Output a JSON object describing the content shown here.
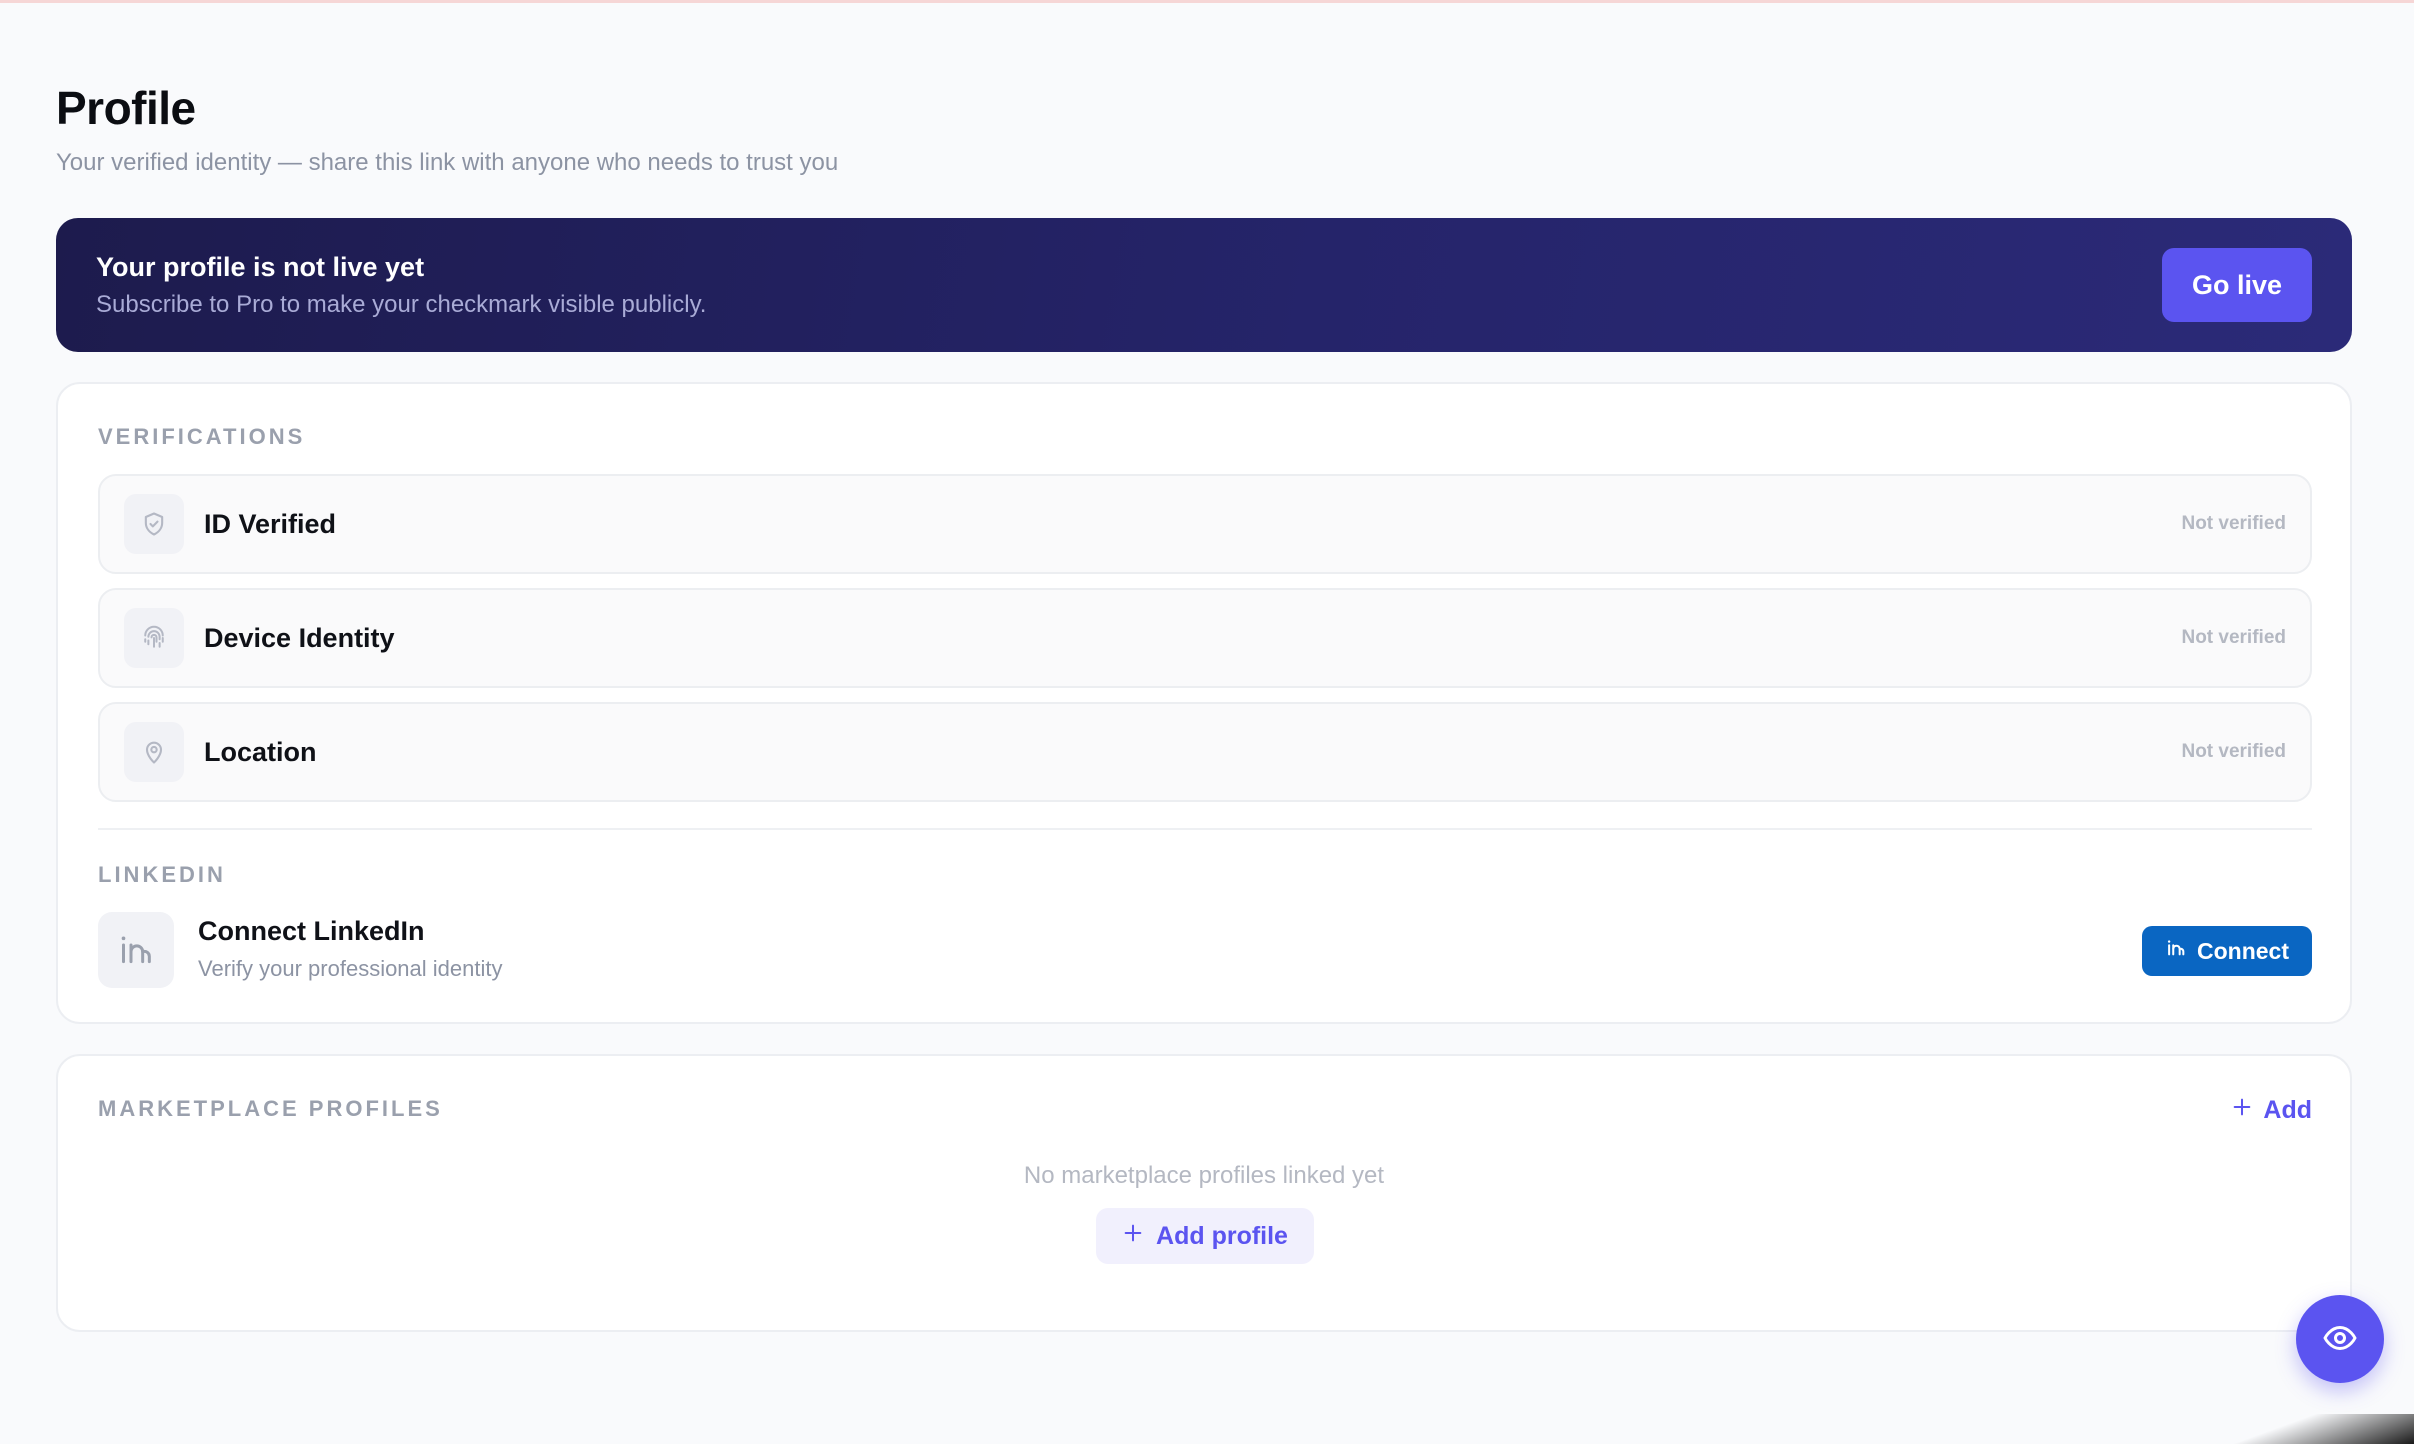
{
  "header": {
    "title": "Profile",
    "subtitle": "Your verified identity — share this link with anyone who needs to trust you"
  },
  "banner": {
    "title": "Your profile is not live yet",
    "subtitle": "Subscribe to Pro to make your checkmark visible publicly.",
    "button_label": "Go live"
  },
  "verifications": {
    "section_label": "VERIFICATIONS",
    "items": [
      {
        "name": "ID Verified",
        "status": "Not verified",
        "icon": "shield-check-icon"
      },
      {
        "name": "Device Identity",
        "status": "Not verified",
        "icon": "fingerprint-icon"
      },
      {
        "name": "Location",
        "status": "Not verified",
        "icon": "map-pin-icon"
      }
    ]
  },
  "linkedin": {
    "section_label": "LINKEDIN",
    "title": "Connect LinkedIn",
    "subtitle": "Verify your professional identity",
    "button_label": "Connect",
    "brand_color": "#0a66c2"
  },
  "marketplace": {
    "section_label": "MARKETPLACE PROFILES",
    "add_label": "Add",
    "empty_text": "No marketplace profiles linked yet",
    "add_profile_label": "Add profile"
  },
  "colors": {
    "accent": "#5b54f0",
    "banner_bg": "#25246a"
  },
  "fab": {
    "icon": "eye-icon"
  }
}
